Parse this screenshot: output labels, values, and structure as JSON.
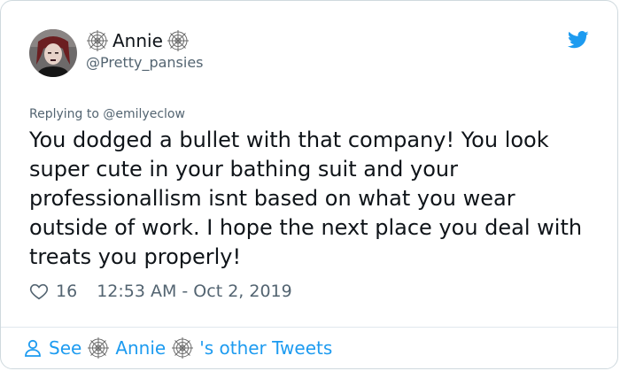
{
  "author": {
    "display_name": "Annie",
    "handle": "@Pretty_pansies"
  },
  "reply": {
    "replying_prefix": "Replying to",
    "mention": "@emilyeclow"
  },
  "tweet": {
    "lines": [
      "You dodged a bullet with that company! You look",
      "super cute in your bathing suit and your",
      "professionallism isnt based on what you wear",
      "outside of work. I hope the next place you deal with",
      "treats you properly!"
    ],
    "likes": "16",
    "timestamp": "12:53 AM - Oct 2, 2019"
  },
  "footer": {
    "see": "See",
    "name": "Annie",
    "suffix": "'s other Tweets"
  },
  "icons": {
    "web": "spiderweb-icon",
    "bird": "twitter-bird-icon",
    "heart": "heart-icon",
    "person": "person-icon"
  },
  "colors": {
    "accent": "#1d9bf0",
    "text": "#0f1419",
    "muted": "#536471"
  }
}
